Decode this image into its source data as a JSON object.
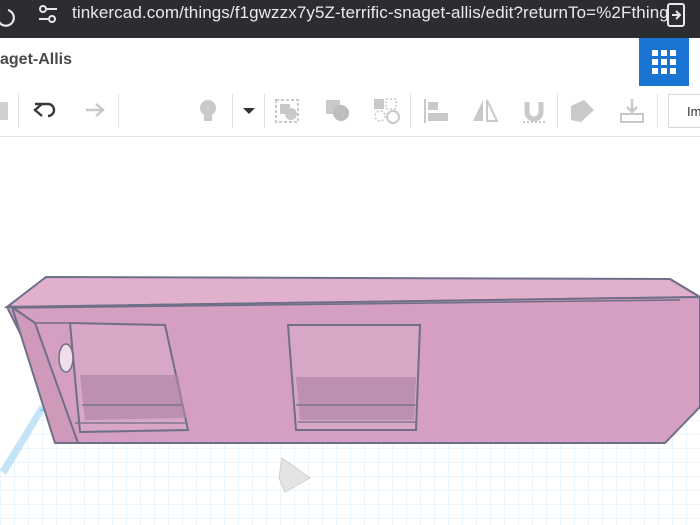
{
  "browser": {
    "url": "tinkercad.com/things/f1gwzzx7y5Z-terrific-snaget-allis/edit?returnTo=%2Fthing"
  },
  "header": {
    "design_name": "aget-Allis"
  },
  "toolbar": {
    "import_label": "Im",
    "tools": [
      "copy-icon",
      "undo-icon",
      "redo-icon",
      "light-bulb-icon",
      "dropdown-caret-icon",
      "group-icon",
      "ungroup-icon",
      "align-icon",
      "mirror-icon",
      "magnet-icon",
      "workplane-icon",
      "ruler-icon",
      "notes-icon",
      "export-icon"
    ]
  },
  "workplane": {
    "shape_color": "#d7a4c0",
    "grid_color": "#cfe6f5",
    "accent_color": "#1a75d2"
  }
}
